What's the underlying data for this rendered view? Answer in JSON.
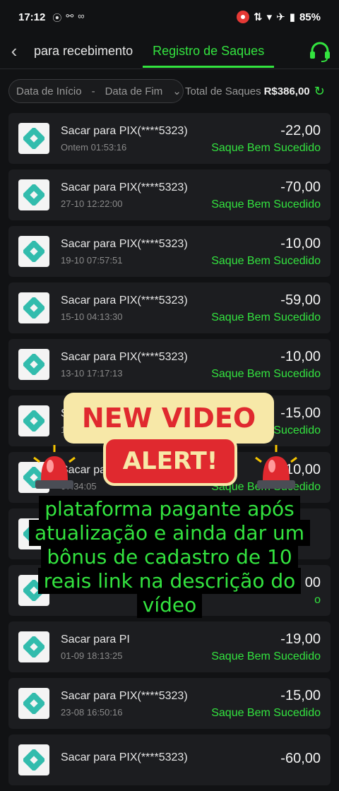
{
  "statusbar": {
    "time": "17:12",
    "battery": "85%"
  },
  "header": {
    "tabs": [
      {
        "label": "para recebimento"
      },
      {
        "label": "Registro de Saques"
      }
    ]
  },
  "filter": {
    "start_placeholder": "Data de Início",
    "end_placeholder": "Data de Fim",
    "total_label": "Total de Saques",
    "total_value": "R$386,00"
  },
  "withdrawals": [
    {
      "title": "Sacar para PIX(****5323)",
      "date": "Ontem 01:53:16",
      "amount": "-22,00",
      "status": "Saque Bem Sucedido"
    },
    {
      "title": "Sacar para PIX(****5323)",
      "date": "27-10 12:22:00",
      "amount": "-70,00",
      "status": "Saque Bem Sucedido"
    },
    {
      "title": "Sacar para PIX(****5323)",
      "date": "19-10 07:57:51",
      "amount": "-10,00",
      "status": "Saque Bem Sucedido"
    },
    {
      "title": "Sacar para PIX(****5323)",
      "date": "15-10 04:13:30",
      "amount": "-59,00",
      "status": "Saque Bem Sucedido"
    },
    {
      "title": "Sacar para PIX(****5323)",
      "date": "13-10 17:17:13",
      "amount": "-10,00",
      "status": "Saque Bem Sucedido"
    },
    {
      "title": "S",
      "date": "1",
      "amount": "-15,00",
      "status": "Saque Bem Sucedido"
    },
    {
      "title": "Sacar para PIX(****5323)",
      "date": "07:34:05",
      "amount": "-10,00",
      "status": "Saque Bem Sucedido"
    },
    {
      "title": "",
      "date": "",
      "amount": "",
      "status": ""
    },
    {
      "title": "",
      "date": "",
      "amount": "00",
      "status": "o"
    },
    {
      "title": "Sacar para PI",
      "date": "01-09 18:13:25",
      "amount": "-19,00",
      "status": "Saque Bem Sucedido"
    },
    {
      "title": "Sacar para PIX(****5323)",
      "date": "23-08 16:50:16",
      "amount": "-15,00",
      "status": "Saque Bem Sucedido"
    },
    {
      "title": "Sacar para PIX(****5323)",
      "date": "",
      "amount": "-60,00",
      "status": ""
    }
  ],
  "overlay": {
    "new_video": "NEW VIDEO",
    "alert": "ALERT!",
    "caption": "plataforma pagante após atualização e ainda dar um bônus de cadastro de 10 reais link na descrição do vídeo"
  },
  "colors": {
    "accent": "#33e33f",
    "bg": "#111214",
    "card": "#1c1d20",
    "alert_red": "#e0292f",
    "alert_cream": "#f7e8a8"
  }
}
